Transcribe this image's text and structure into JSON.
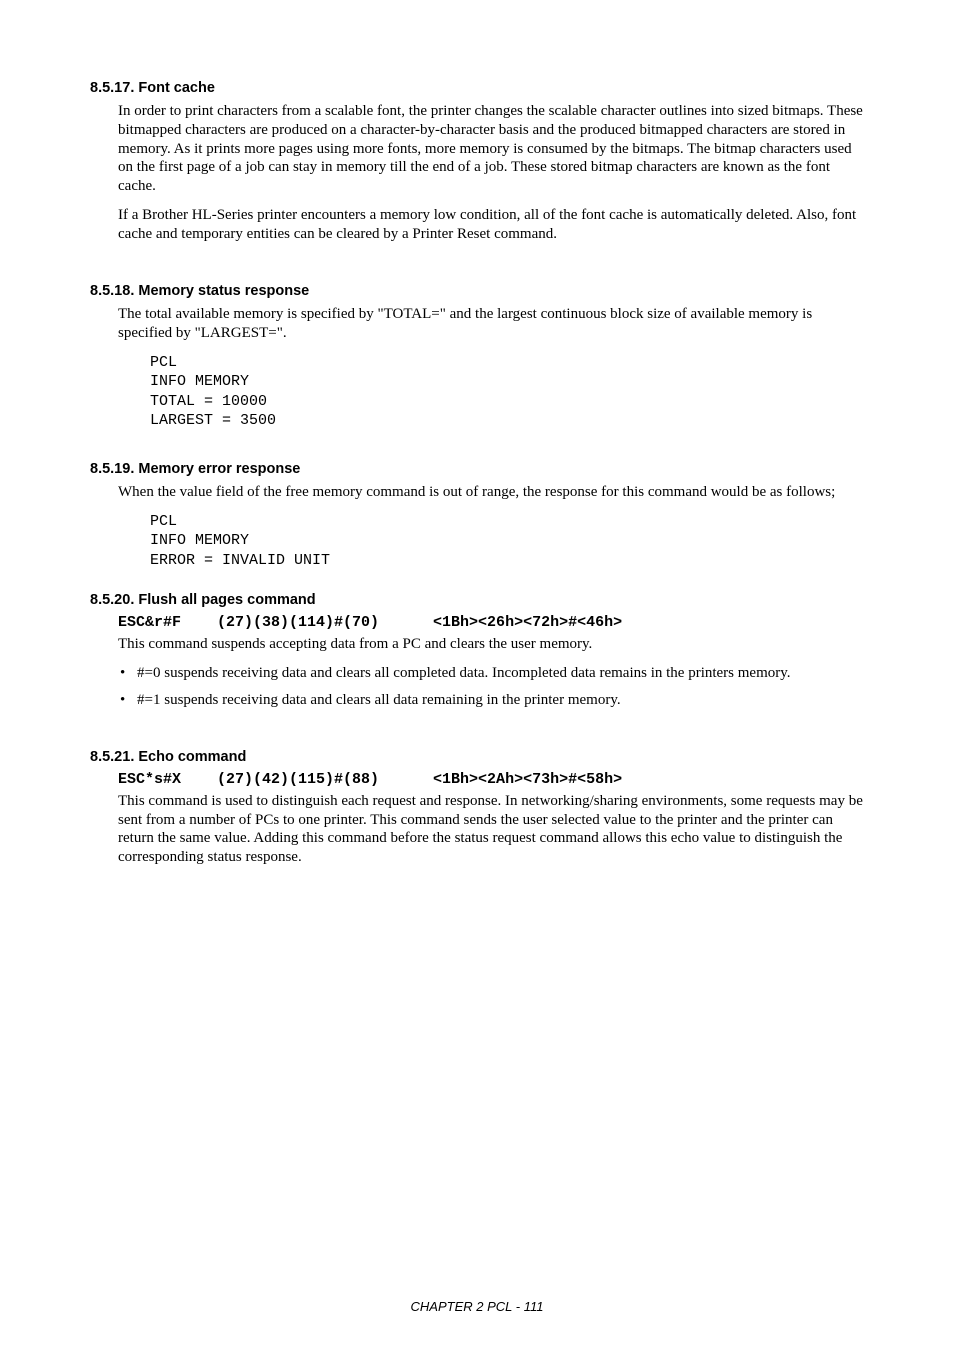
{
  "sections": {
    "s17": {
      "heading": "8.5.17.  Font cache",
      "p1": "In order to print characters from a scalable font, the printer changes the scalable character outlines into sized bitmaps. These bitmapped characters are produced on a character-by-character basis and the produced bitmapped characters are stored in memory. As it prints more pages using more fonts, more memory is consumed by the bitmaps. The bitmap characters used on the first page of a job can stay in memory till the end of a job. These stored bitmap characters are known as the font cache.",
      "p2": "If a Brother HL-Series printer encounters a memory low condition, all of the font cache is automatically deleted. Also,  font cache and temporary entities can be cleared by a Printer Reset command."
    },
    "s18": {
      "heading": "8.5.18.  Memory status response",
      "p1": "The total available memory is specified by \"TOTAL=\" and the largest continuous block size of available memory  is specified by \"LARGEST=\".",
      "code": "PCL\nINFO MEMORY\nTOTAL = 10000\nLARGEST = 3500"
    },
    "s19": {
      "heading": "8.5.19.  Memory error response",
      "p1": "When the value field of the free memory command is out of range,  the response for this command would be as follows;",
      "code": "PCL\nINFO MEMORY\nERROR = INVALID UNIT"
    },
    "s20": {
      "heading": "8.5.20.  Flush all pages command",
      "codeline": "ESC&r#F    (27)(38)(114)#(70)      <1Bh><26h><72h>#<46h>",
      "p1": "This command suspends accepting data from a PC and clears the user memory.",
      "b1": "#=0 suspends receiving data and clears all completed data. Incompleted data remains in the printers memory.",
      "b2": "#=1 suspends receiving data and clears all data remaining in the printer memory."
    },
    "s21": {
      "heading": "8.5.21.  Echo command",
      "codeline": "ESC*s#X    (27)(42)(115)#(88)      <1Bh><2Ah><73h>#<58h>",
      "p1": "This command is used to distinguish each request and response.  In networking/sharing environments,  some requests may be sent from a number of PCs to one printer. This command sends the user selected value to the printer and the printer can return the same value. Adding this command before the status request command allows  this echo value to distinguish the corresponding status response."
    }
  },
  "footer": "CHAPTER 2 PCL - 111"
}
